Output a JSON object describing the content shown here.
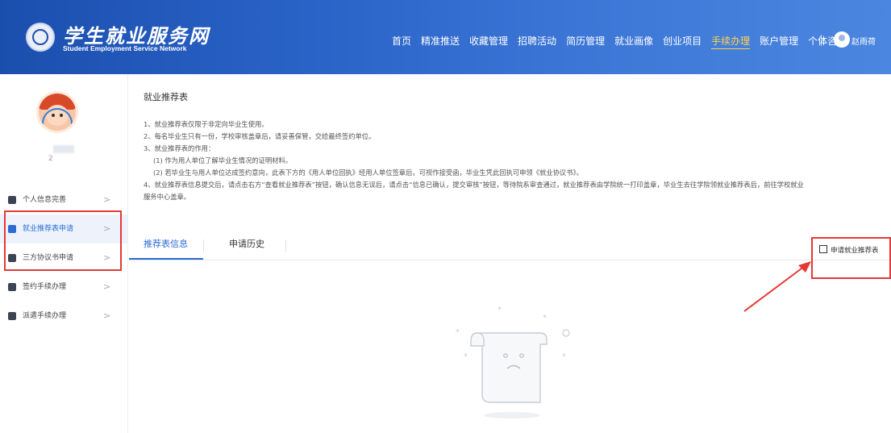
{
  "header": {
    "logo_title": "学生就业服务网",
    "logo_subtitle": "Student Employment Service Network",
    "nav": [
      {
        "label": "首页",
        "active": false
      },
      {
        "label": "精准推送",
        "active": false
      },
      {
        "label": "收藏管理",
        "active": false
      },
      {
        "label": "招聘活动",
        "active": false
      },
      {
        "label": "简历管理",
        "active": false
      },
      {
        "label": "就业画像",
        "active": false
      },
      {
        "label": "创业项目",
        "active": false
      },
      {
        "label": "手续办理",
        "active": true
      },
      {
        "label": "账户管理",
        "active": false
      },
      {
        "label": "个体咨询",
        "active": false
      }
    ],
    "user_name": "赵雨荷"
  },
  "sidebar": {
    "profile_id": "2",
    "items": [
      {
        "label": "个人信息完善",
        "icon": "user-icon",
        "active": false
      },
      {
        "label": "就业推荐表申请",
        "icon": "document-icon",
        "active": true
      },
      {
        "label": "三方协议书申请",
        "icon": "contract-icon",
        "active": false
      },
      {
        "label": "签约手续办理",
        "icon": "briefcase-icon",
        "active": false
      },
      {
        "label": "派遣手续办理",
        "icon": "dispatch-icon",
        "active": false
      }
    ]
  },
  "main": {
    "title": "就业推荐表",
    "notes": [
      "1、就业推荐表仅限于非定向毕业生使用。",
      "2、每名毕业生只有一份，学校审核盖章后，请妥善保管，交给最终签约单位。",
      "3、就业推荐表的作用：",
      "(1) 作为用人单位了解毕业生情况的证明材料。",
      "(2) 若毕业生与用人单位达成签约意向，此表下方的《用人单位回执》经用人单位签章后，可视作接受函，毕业生凭此回执可申领《就业协议书》。",
      "4、就业推荐表信息提交后，请点击右方“查看就业推荐表”按钮，确认信息无误后，请点击“信息已确认，提交审核”按钮，等待院系审查通过，就业推荐表由学院统一打印盖章，毕业生去往学院领就业推荐表后，前往学校就业",
      "服务中心盖章。"
    ],
    "tabs": [
      {
        "label": "推荐表信息",
        "active": true
      },
      {
        "label": "申请历史",
        "active": false
      }
    ],
    "apply_button": "申请就业推荐表"
  },
  "colors": {
    "header_start": "#1b4fae",
    "header_end": "#4b86e0",
    "accent": "#2b6cd6",
    "nav_active": "#ffd54a",
    "annotation_red": "#e53935"
  }
}
